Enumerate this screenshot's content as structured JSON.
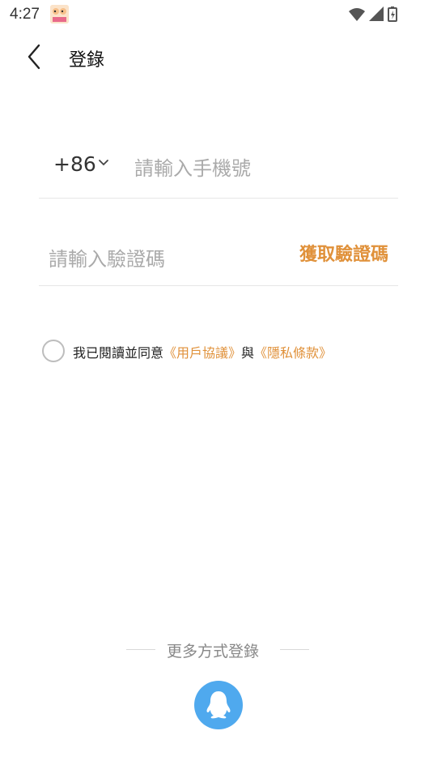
{
  "status_bar": {
    "time": "4:27",
    "icons": [
      "app-notification-icon",
      "wifi-icon",
      "cell-signal-icon",
      "battery-charging-icon"
    ]
  },
  "header": {
    "title": "登錄",
    "back_icon": "back-arrow-icon"
  },
  "login_form": {
    "country_code": "+86",
    "phone_placeholder": "請輸入手機號",
    "code_placeholder": "請輸入驗證碼",
    "get_code_label": "獲取驗證碼"
  },
  "agreement": {
    "prefix": "我已閱讀並同意",
    "user_agreement": "《用戶協議》",
    "conjunction": "與",
    "privacy_policy": "《隱私條款》"
  },
  "alt_login": {
    "label": "更多方式登錄",
    "qq_icon": "qq-penguin-icon"
  },
  "colors": {
    "accent": "#e0913a",
    "qq_blue": "#4fa9ee",
    "divider": "#e6e6e6"
  }
}
